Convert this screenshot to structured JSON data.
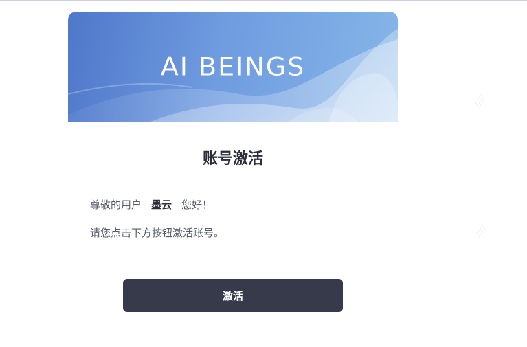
{
  "email": {
    "brand": "AI BEINGS",
    "title": "账号激活",
    "greeting_prefix": "尊敬的用户",
    "username": "墨云",
    "greeting_suffix": "您好！",
    "instruction": "请您点击下方按钮激活账号。",
    "activate_label": "激活"
  },
  "colors": {
    "banner_start": "#4f78c9",
    "banner_end": "#86b6e8",
    "button": "#363a4b",
    "title_text": "#2a2d3a",
    "body_text": "#555b68"
  }
}
